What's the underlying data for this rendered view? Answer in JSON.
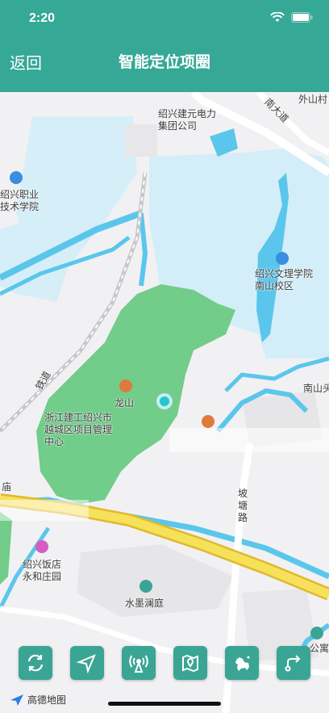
{
  "status_bar": {
    "time": "2:20"
  },
  "nav": {
    "back_label": "返回",
    "title": "智能定位项圈"
  },
  "map": {
    "labels": {
      "top_road": "外山村",
      "highway_sign": "南大道",
      "power_company": "绍兴建元电力集团公司",
      "vocational_college": "绍兴职业技术学院",
      "wenli_college": "绍兴文理学院南山校区",
      "longshan": "龙山",
      "construction_center": "浙江建工绍兴市越城区项目管理中心",
      "nanshan": "南山头",
      "rail": "铁道",
      "potang_road": "坡塘路",
      "restaurant": "绍兴饭店永和庄园",
      "shuimo": "水墨澜庭",
      "apartment": "公寓",
      "left_partial": "庙"
    }
  },
  "toolbar": {
    "buttons": [
      {
        "name": "refresh-button",
        "icon": "refresh-icon"
      },
      {
        "name": "locate-button",
        "icon": "navigation-arrow-icon"
      },
      {
        "name": "signal-button",
        "icon": "signal-tower-icon"
      },
      {
        "name": "map-fence-button",
        "icon": "map-pin-icon"
      },
      {
        "name": "pet-button",
        "icon": "dog-icon"
      },
      {
        "name": "track-button",
        "icon": "route-icon"
      }
    ]
  },
  "map_logo": {
    "label": "高德地图"
  },
  "colors": {
    "accent": "#35a896",
    "button": "#3aa595",
    "park": "#72cc8a",
    "water": "#5bc6ec",
    "highway": "#f2d23b"
  }
}
